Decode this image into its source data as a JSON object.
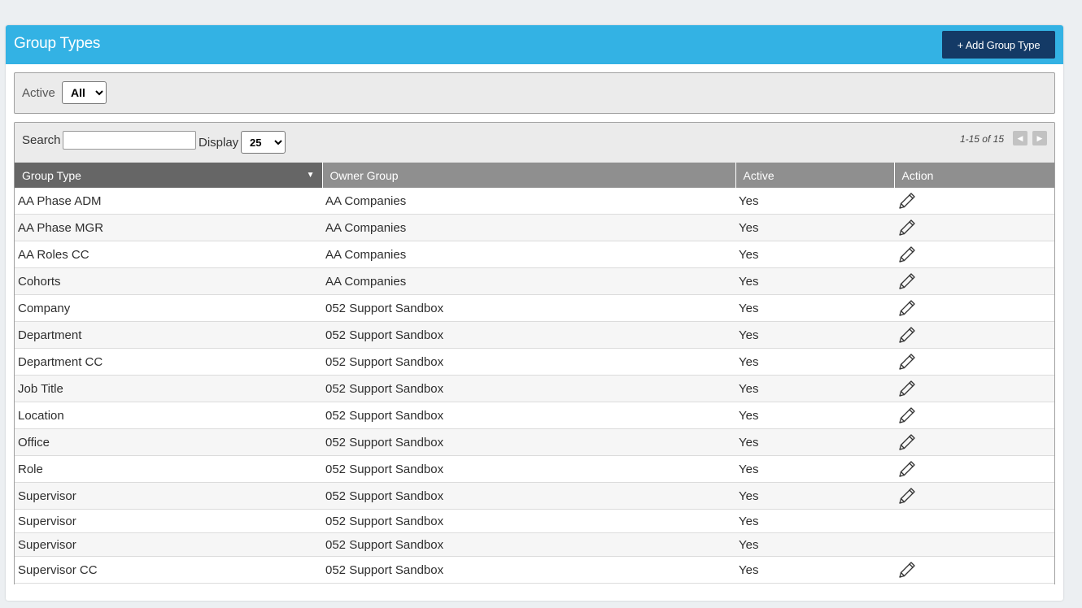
{
  "header": {
    "title": "Group Types",
    "add_button_label": "+ Add Group Type"
  },
  "filter": {
    "active_label": "Active",
    "active_selected": "All"
  },
  "toolbar": {
    "search_label": "Search",
    "search_value": "",
    "display_label": "Display",
    "display_selected": "25",
    "pager_text": "1-15 of 15",
    "prev_icon": "triangle-left-icon",
    "next_icon": "triangle-right-icon"
  },
  "columns": {
    "group_type": "Group Type",
    "owner_group": "Owner Group",
    "active": "Active",
    "action": "Action"
  },
  "rows": [
    {
      "group_type": "AA Phase ADM",
      "owner_group": "AA Companies",
      "active": "Yes",
      "editable": true
    },
    {
      "group_type": "AA Phase MGR",
      "owner_group": "AA Companies",
      "active": "Yes",
      "editable": true
    },
    {
      "group_type": "AA Roles CC",
      "owner_group": "AA Companies",
      "active": "Yes",
      "editable": true
    },
    {
      "group_type": "Cohorts",
      "owner_group": "AA Companies",
      "active": "Yes",
      "editable": true
    },
    {
      "group_type": "Company",
      "owner_group": "052 Support Sandbox",
      "active": "Yes",
      "editable": true
    },
    {
      "group_type": "Department",
      "owner_group": "052 Support Sandbox",
      "active": "Yes",
      "editable": true
    },
    {
      "group_type": "Department CC",
      "owner_group": "052 Support Sandbox",
      "active": "Yes",
      "editable": true
    },
    {
      "group_type": "Job Title",
      "owner_group": "052 Support Sandbox",
      "active": "Yes",
      "editable": true
    },
    {
      "group_type": "Location",
      "owner_group": "052 Support Sandbox",
      "active": "Yes",
      "editable": true
    },
    {
      "group_type": "Office",
      "owner_group": "052 Support Sandbox",
      "active": "Yes",
      "editable": true
    },
    {
      "group_type": "Role",
      "owner_group": "052 Support Sandbox",
      "active": "Yes",
      "editable": true
    },
    {
      "group_type": "Supervisor",
      "owner_group": "052 Support Sandbox",
      "active": "Yes",
      "editable": true
    },
    {
      "group_type": "Supervisor",
      "owner_group": "052 Support Sandbox",
      "active": "Yes",
      "editable": false
    },
    {
      "group_type": "Supervisor",
      "owner_group": "052 Support Sandbox",
      "active": "Yes",
      "editable": false
    },
    {
      "group_type": "Supervisor CC",
      "owner_group": "052 Support Sandbox",
      "active": "Yes",
      "editable": true
    }
  ],
  "colors": {
    "header_bg": "#33b2e4",
    "button_bg": "#143a66",
    "column_header_bg": "#8f8f8f",
    "sorted_header_bg": "#666666"
  },
  "icons": {
    "edit": "pencil-icon",
    "sort": "sort-descending-icon"
  }
}
